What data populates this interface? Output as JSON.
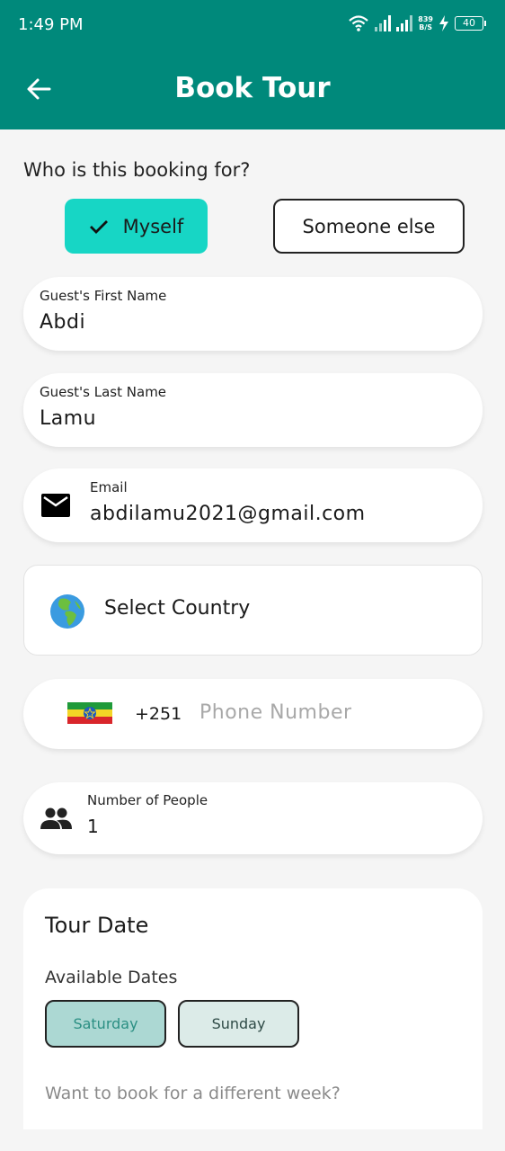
{
  "status_bar": {
    "time": "1:49 PM",
    "net_speed": "839",
    "net_unit": "B/S",
    "battery": "40"
  },
  "header": {
    "title": "Book Tour"
  },
  "booking_for": {
    "question": "Who is this booking for?",
    "options": [
      {
        "label": "Myself",
        "selected": true
      },
      {
        "label": "Someone else",
        "selected": false
      }
    ]
  },
  "form": {
    "first_name": {
      "label": "Guest's First Name",
      "value": "Abdi"
    },
    "last_name": {
      "label": "Guest's Last Name",
      "value": "Lamu"
    },
    "email": {
      "label": "Email",
      "value": "abdilamu2021@gmail.com"
    },
    "country": {
      "placeholder": "Select Country"
    },
    "phone": {
      "dial_code": "+251",
      "placeholder": "Phone Number"
    },
    "people": {
      "label": "Number of People",
      "value": "1"
    }
  },
  "tour_date": {
    "title": "Tour Date",
    "available_label": "Available Dates",
    "dates": [
      "Saturday",
      "Sunday"
    ],
    "different_week": "Want to book for a different week?"
  },
  "colors": {
    "header": "#00897b",
    "selected_choice": "#17d6c5",
    "saturday": "#acd8d3",
    "sunday": "#dcebe8"
  },
  "icons": [
    "back-arrow-icon",
    "check-icon",
    "mail-icon",
    "globe-icon",
    "ethiopia-flag-icon",
    "people-icon"
  ]
}
